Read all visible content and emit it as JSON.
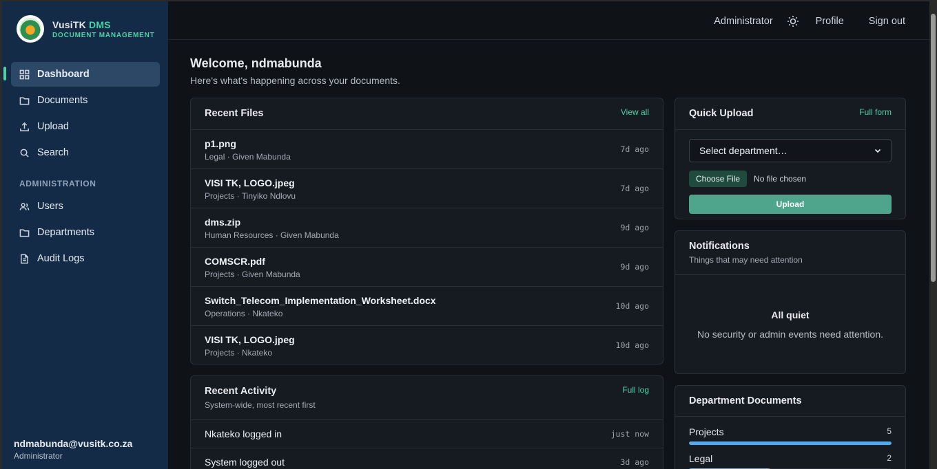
{
  "brand": {
    "name_a": "VusiTK",
    "name_b": "DMS",
    "subtitle": "DOCUMENT MANAGEMENT"
  },
  "sidebar": {
    "items": [
      {
        "label": "Dashboard",
        "icon": "grid-icon"
      },
      {
        "label": "Documents",
        "icon": "folder-icon"
      },
      {
        "label": "Upload",
        "icon": "upload-icon"
      },
      {
        "label": "Search",
        "icon": "search-icon"
      }
    ],
    "section": "ADMINISTRATION",
    "admin_items": [
      {
        "label": "Users",
        "icon": "users-icon"
      },
      {
        "label": "Departments",
        "icon": "folder-icon"
      },
      {
        "label": "Audit Logs",
        "icon": "file-icon"
      }
    ],
    "user_email": "ndmabunda@vusitk.co.za",
    "user_role": "Administrator"
  },
  "topbar": {
    "role": "Administrator",
    "profile": "Profile",
    "signout": "Sign out"
  },
  "main": {
    "welcome": "Welcome, ndmabunda",
    "subtitle": "Here's what's happening across your documents."
  },
  "recent_files": {
    "title": "Recent Files",
    "link": "View all",
    "rows": [
      {
        "name": "p1.png",
        "meta": "Legal · Given Mabunda",
        "time": "7d ago"
      },
      {
        "name": "VISI TK, LOGO.jpeg",
        "meta": "Projects · Tinyiko Ndlovu",
        "time": "7d ago"
      },
      {
        "name": "dms.zip",
        "meta": "Human Resources · Given Mabunda",
        "time": "9d ago"
      },
      {
        "name": "COMSCR.pdf",
        "meta": "Projects · Given Mabunda",
        "time": "9d ago"
      },
      {
        "name": "Switch_Telecom_Implementation_Worksheet.docx",
        "meta": "Operations · Nkateko",
        "time": "10d ago"
      },
      {
        "name": "VISI TK, LOGO.jpeg",
        "meta": "Projects · Nkateko",
        "time": "10d ago"
      }
    ]
  },
  "recent_activity": {
    "title": "Recent Activity",
    "subtitle": "System-wide, most recent first",
    "link": "Full log",
    "rows": [
      {
        "text": "Nkateko logged in",
        "time": "just now"
      },
      {
        "text": "System logged out",
        "time": "3d ago"
      }
    ]
  },
  "quick_upload": {
    "title": "Quick Upload",
    "link": "Full form",
    "select_value": "Select department…",
    "choose": "Choose File",
    "no_file": "No file chosen",
    "button": "Upload"
  },
  "notifications": {
    "title": "Notifications",
    "subtitle": "Things that may need attention",
    "empty_title": "All quiet",
    "empty_text": "No security or admin events need attention."
  },
  "departments": {
    "title": "Department Documents",
    "rows": [
      {
        "name": "Projects",
        "count": "5",
        "fraction": 1.0
      },
      {
        "name": "Legal",
        "count": "2",
        "fraction": 0.4
      }
    ]
  },
  "colors": {
    "accent": "#4fd1a5",
    "bar": "#5aa9e6",
    "sidebar": "#132b47"
  }
}
